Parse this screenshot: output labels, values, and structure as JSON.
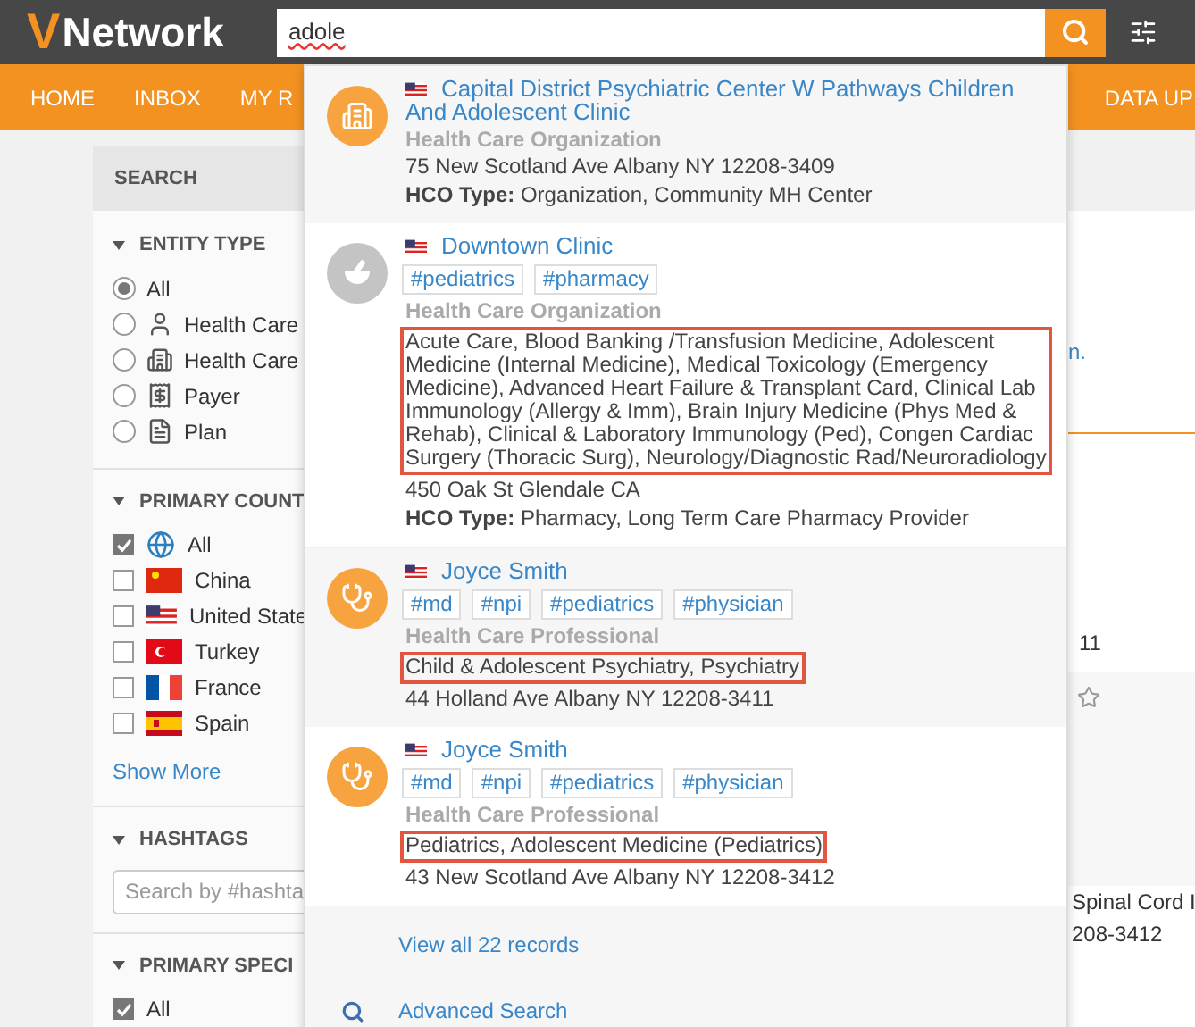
{
  "header": {
    "logo_mark": "V",
    "logo_text": "Network",
    "search_value": "adole"
  },
  "nav": [
    {
      "label": "HOME"
    },
    {
      "label": "INBOX"
    },
    {
      "label": "MY R"
    },
    {
      "label": "DATA UP"
    }
  ],
  "sidebar": {
    "title": "SEARCH",
    "entity_type": {
      "title": "ENTITY TYPE",
      "options": [
        {
          "label": "All",
          "kind": "none",
          "selected": true
        },
        {
          "label": "Health Care",
          "kind": "person",
          "selected": false
        },
        {
          "label": "Health Care",
          "kind": "building",
          "selected": false
        },
        {
          "label": "Payer",
          "kind": "payer",
          "selected": false
        },
        {
          "label": "Plan",
          "kind": "plan",
          "selected": false
        }
      ]
    },
    "countries": {
      "title": "PRIMARY COUNT",
      "options": [
        {
          "label": "All",
          "kind": "globe",
          "checked": true
        },
        {
          "label": "China",
          "kind": "china",
          "checked": false
        },
        {
          "label": "United State",
          "kind": "us",
          "checked": false
        },
        {
          "label": "Turkey",
          "kind": "turkey",
          "checked": false
        },
        {
          "label": "France",
          "kind": "france",
          "checked": false
        },
        {
          "label": "Spain",
          "kind": "spain",
          "checked": false
        }
      ],
      "show_more": "Show More"
    },
    "hashtags": {
      "title": "HASHTAGS",
      "placeholder": "Search by #hashta"
    },
    "specialty": {
      "title": "PRIMARY SPECI",
      "options": [
        {
          "label": "All",
          "checked": true
        }
      ]
    }
  },
  "background_fragments": [
    {
      "kind": "link",
      "text": "n."
    },
    {
      "kind": "text",
      "text": "11"
    },
    {
      "kind": "text",
      "text": "Spinal Cord I"
    },
    {
      "kind": "text",
      "text": "208-3412"
    }
  ],
  "results": [
    {
      "kind": "hospital",
      "name": "Capital District Psychiatric Center W Pathways Children And Adolescent Clinic",
      "type": "Health Care Organization",
      "address": "75 New Scotland Ave Albany NY 12208-3409",
      "hco_label": "HCO Type:",
      "hco_type": "Organization, Community MH Center"
    },
    {
      "kind": "pharmacy",
      "name": "Downtown Clinic",
      "tags": [
        "#pediatrics",
        "#pharmacy"
      ],
      "type": "Health Care Organization",
      "specialties": "Acute Care, Blood Banking /Transfusion Medicine, Adolescent Medicine (Internal Medicine), Medical Toxicology (Emergency Medicine), Advanced Heart Failure & Transplant Card, Clinical Lab Immunology (Allergy & Imm), Brain Injury Medicine (Phys Med & Rehab), Clinical & Laboratory Immunology (Ped), Congen Cardiac Surgery (Thoracic Surg), Neurology/Diagnostic Rad/Neuroradiology",
      "address": "450 Oak St Glendale CA",
      "hco_label": "HCO Type:",
      "hco_type": "Pharmacy, Long Term Care Pharmacy Provider"
    },
    {
      "kind": "doctor",
      "name": "Joyce Smith",
      "tags": [
        "#md",
        "#npi",
        "#pediatrics",
        "#physician"
      ],
      "type": "Health Care Professional",
      "specialties": "Child & Adolescent Psychiatry, Psychiatry",
      "address": "44 Holland Ave Albany NY 12208-3411"
    },
    {
      "kind": "doctor",
      "name": "Joyce Smith",
      "tags": [
        "#md",
        "#npi",
        "#pediatrics",
        "#physician"
      ],
      "type": "Health Care Professional",
      "specialties": "Pediatrics, Adolescent Medicine (Pediatrics)",
      "address": "43 New Scotland Ave Albany NY 12208-3412"
    }
  ],
  "footer": {
    "view_all": "View all 22 records",
    "advanced": "Advanced Search"
  }
}
